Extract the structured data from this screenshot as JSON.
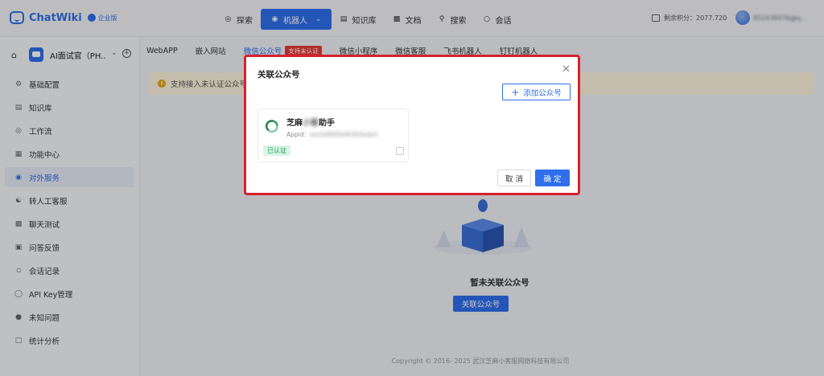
{
  "header": {
    "brand": "ChatWiki",
    "edition_badge": "企业版",
    "nav": [
      {
        "label": "探索",
        "icon": "compass-icon"
      },
      {
        "label": "机器人",
        "icon": "robot-icon",
        "active": true
      },
      {
        "label": "知识库",
        "icon": "book-icon"
      },
      {
        "label": "文档",
        "icon": "document-icon"
      },
      {
        "label": "搜索",
        "icon": "search-icon"
      },
      {
        "label": "会话",
        "icon": "chat-icon"
      }
    ],
    "points": "剩余积分：2077.720",
    "username": "852438476@q..."
  },
  "sidebar": {
    "app_name": "AI面试官（PH...",
    "items": [
      {
        "label": "基础配置",
        "icon": "gear-icon"
      },
      {
        "label": "知识库",
        "icon": "book-icon"
      },
      {
        "label": "工作流",
        "icon": "workflow-icon"
      },
      {
        "label": "功能中心",
        "icon": "grid-icon"
      },
      {
        "label": "对外服务",
        "icon": "service-icon",
        "active": true
      },
      {
        "label": "转人工客服",
        "icon": "agent-icon"
      },
      {
        "label": "聊天测试",
        "icon": "chat-test-icon"
      },
      {
        "label": "问答反馈",
        "icon": "feedback-icon"
      },
      {
        "label": "会话记录",
        "icon": "history-icon"
      },
      {
        "label": "API Key管理",
        "icon": "key-icon"
      },
      {
        "label": "未知问题",
        "icon": "question-icon"
      },
      {
        "label": "统计分析",
        "icon": "stats-icon"
      }
    ]
  },
  "main": {
    "tabs": [
      {
        "label": "WebAPP"
      },
      {
        "label": "嵌入网站"
      },
      {
        "label": "微信公众号",
        "active": true,
        "badge": "支持未认证"
      },
      {
        "label": "微信小程序"
      },
      {
        "label": "微信客服"
      },
      {
        "label": "飞书机器人"
      },
      {
        "label": "钉钉机器人"
      }
    ],
    "notice": "支持接入未认证公众号",
    "empty_title": "暂未关联公众号",
    "empty_button": "关联公众号",
    "copyright": "Copyright © 2016- 2025 武汉芝麻小客服网络科技有限公司"
  },
  "dialog": {
    "title": "关联公众号",
    "add_button": "添加公众号",
    "card": {
      "name_start": "芝麻",
      "name_hidden": "小客",
      "name_end": "助手",
      "appid_label": "Appid：",
      "appid_value": "wx2e6805ef63b5ede3",
      "status": "已认证"
    },
    "cancel_label": "取 消",
    "confirm_label": "确 定"
  },
  "colors": {
    "primary": "#2f6feb",
    "highlight_border": "#d8212f",
    "verified_green": "#25a05a",
    "notice_bg": "#fdf3dd"
  }
}
